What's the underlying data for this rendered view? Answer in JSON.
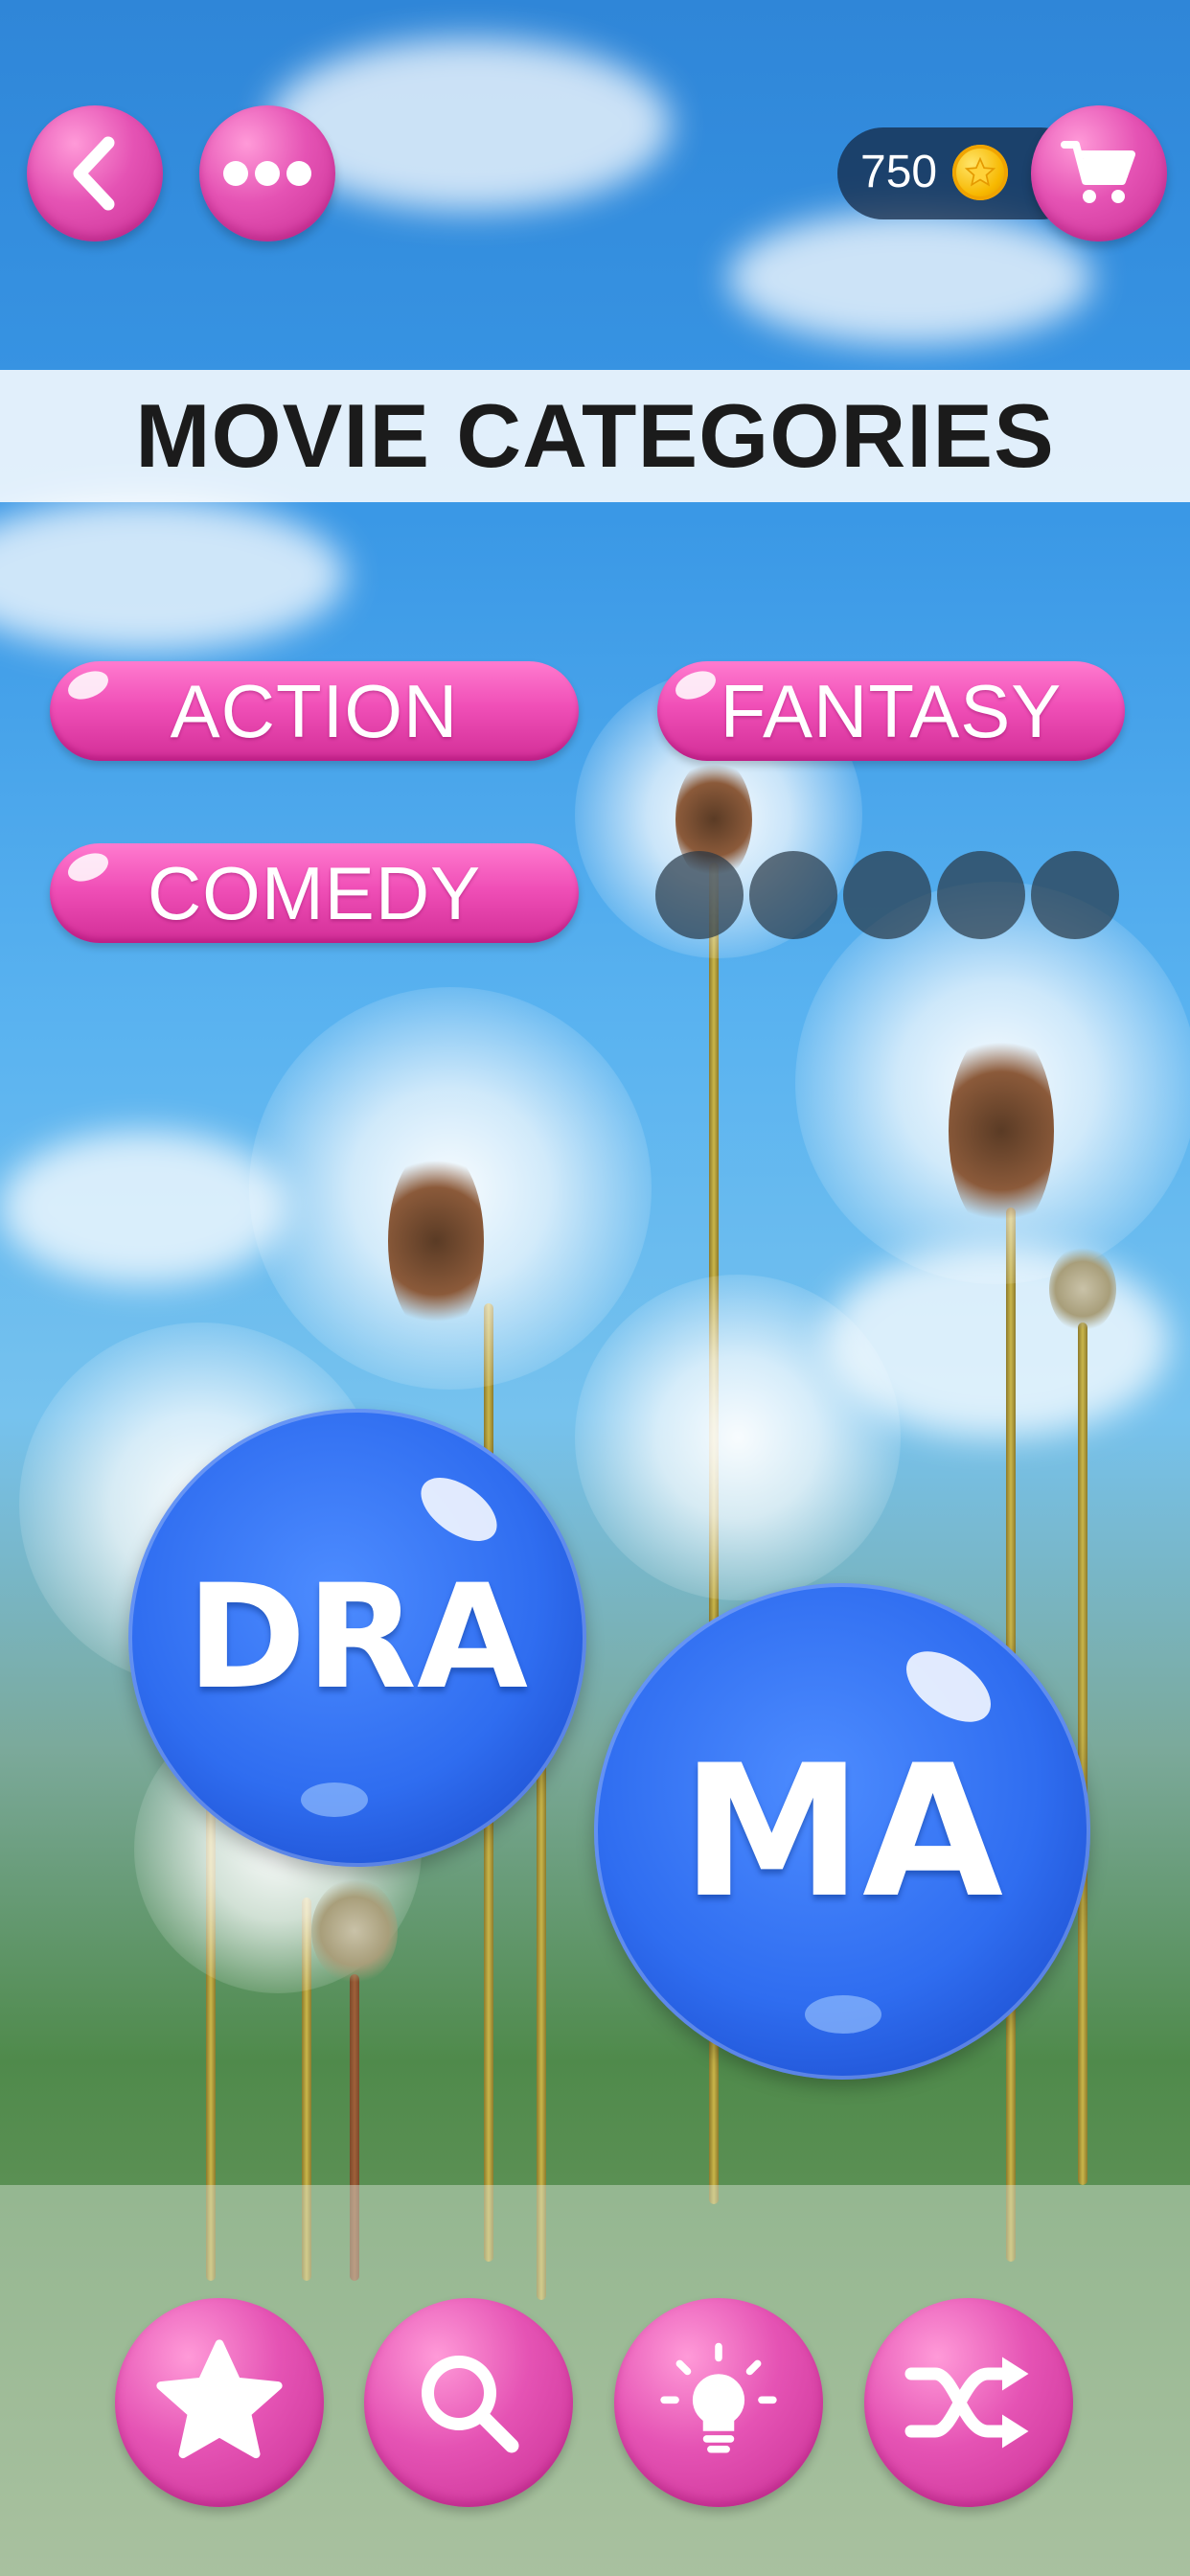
{
  "header": {
    "back_icon": "chevron-left-icon",
    "more_icon": "ellipsis-icon",
    "coins": "750",
    "coin_icon": "coin-star-icon",
    "shop_icon": "shopping-cart-icon"
  },
  "title": "MOVIE CATEGORIES",
  "found_words": [
    "ACTION",
    "FANTASY",
    "COMEDY"
  ],
  "hidden_word": {
    "letters_remaining": 5
  },
  "bubbles": [
    "DRA",
    "MA"
  ],
  "tools": [
    {
      "icon": "star-icon"
    },
    {
      "icon": "magnifier-icon"
    },
    {
      "icon": "lightbulb-icon"
    },
    {
      "icon": "shuffle-icon"
    }
  ],
  "colors": {
    "accent_pink": "#e553b4",
    "bubble_blue": "#2f6df0",
    "slot_dark": "#28374680"
  }
}
